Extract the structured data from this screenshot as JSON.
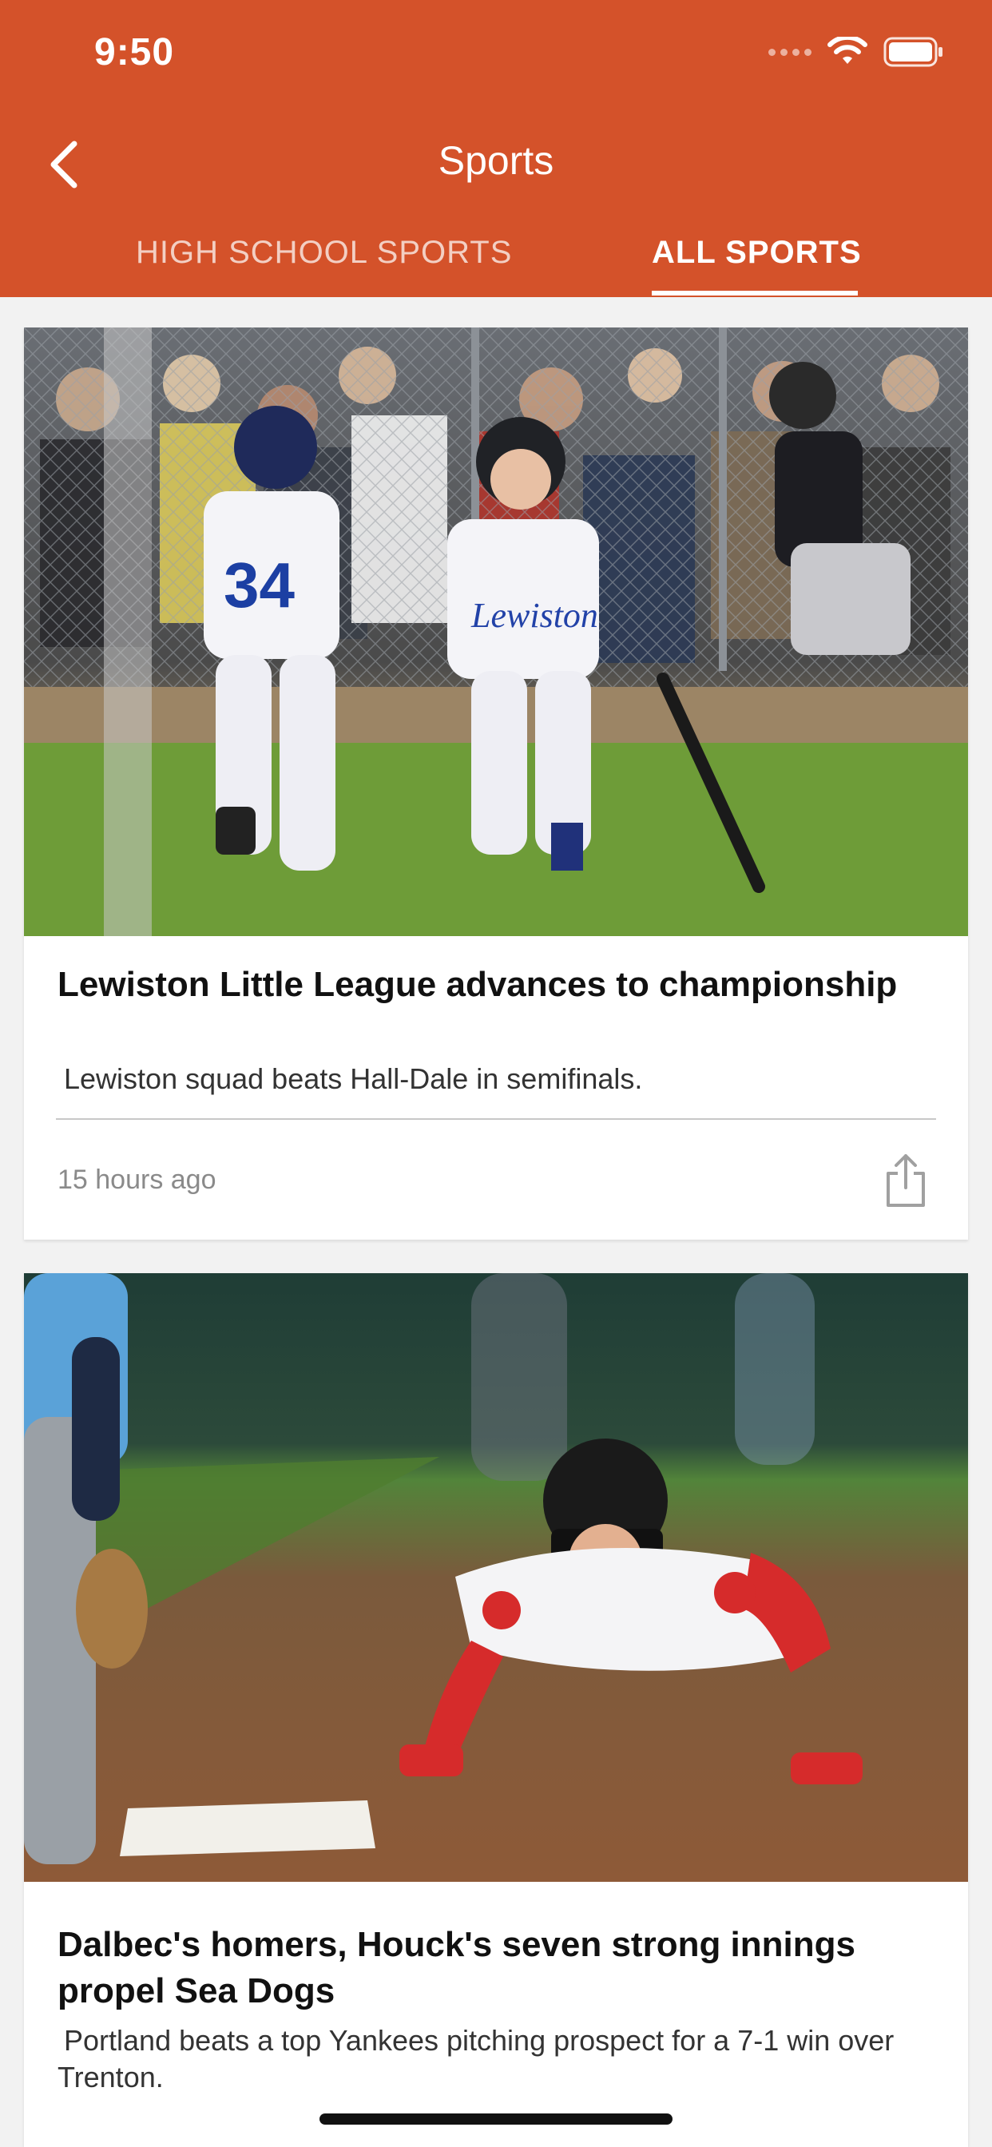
{
  "status_bar": {
    "time": "9:50"
  },
  "header": {
    "title": "Sports",
    "back_icon": "chevron-left-icon",
    "background_color": "#d4522a"
  },
  "tabs": [
    {
      "label": "HIGH SCHOOL SPORTS",
      "selected": false
    },
    {
      "label": "ALL SPORTS",
      "selected": true
    }
  ],
  "articles": [
    {
      "title": "Lewiston Little League advances to championship",
      "summary": "Lewiston squad beats Hall-Dale in semifinals.",
      "time_ago": "15 hours ago",
      "share_icon": "share-icon"
    },
    {
      "title": "Dalbec's homers, Houck's seven strong innings propel Sea Dogs",
      "summary": "Portland beats a top Yankees pitching prospect for a 7-1 win over Trenton."
    }
  ]
}
